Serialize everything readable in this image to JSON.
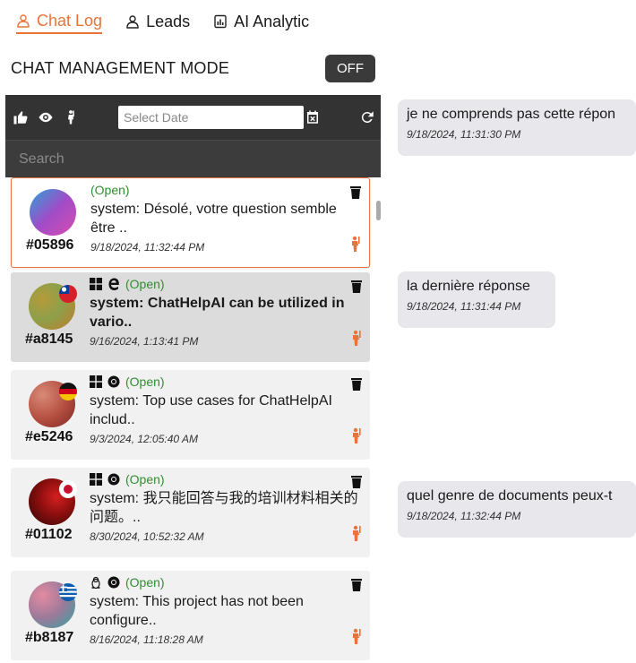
{
  "tabs": [
    {
      "label": "Chat Log",
      "icon": "user-icon",
      "active": true
    },
    {
      "label": "Leads",
      "icon": "person-icon",
      "active": false
    },
    {
      "label": "AI Analytic",
      "icon": "analytics-icon",
      "active": false
    }
  ],
  "mode": {
    "title": "CHAT MANAGEMENT MODE",
    "toggle_label": "OFF"
  },
  "toolbar": {
    "date_placeholder": "Select Date",
    "search_placeholder": "Search"
  },
  "chats": [
    {
      "id": "#05896",
      "status": "(Open)",
      "message": "system: Désolé, votre question semble être ..",
      "time": "9/18/2024, 11:32:44 PM",
      "bold": false,
      "os": "",
      "browser": "",
      "flag": ""
    },
    {
      "id": "#a8145",
      "status": "(Open)",
      "message": "system: ChatHelpAI can be utilized in vario..",
      "time": "9/16/2024, 1:13:41 PM",
      "bold": true,
      "os": "windows-icon",
      "browser": "edge-icon",
      "flag": "taiwan-flag-icon"
    },
    {
      "id": "#e5246",
      "status": "(Open)",
      "message": "system: Top use cases for ChatHelpAI includ..",
      "time": "9/3/2024, 12:05:40 AM",
      "bold": false,
      "os": "windows-icon",
      "browser": "chrome-icon",
      "flag": "germany-flag-icon"
    },
    {
      "id": "#01102",
      "status": "(Open)",
      "message": "system: 我只能回答与我的培训材料相关的问题。..",
      "time": "8/30/2024, 10:52:32 AM",
      "bold": false,
      "os": "windows-icon",
      "browser": "chrome-icon",
      "flag": "japan-flag-icon"
    },
    {
      "id": "#b8187",
      "status": "(Open)",
      "message": "system: This project has not been configure..",
      "time": "8/16/2024, 11:18:28 AM",
      "bold": false,
      "os": "linux-icon",
      "browser": "chrome-icon",
      "flag": "greece-flag-icon"
    }
  ],
  "conversation": [
    {
      "text": "je ne comprends pas cette répon",
      "time": "9/18/2024, 11:31:30 PM"
    },
    {
      "text": "la dernière réponse",
      "time": "9/18/2024, 11:31:44 PM"
    },
    {
      "text": "quel genre de documents peux-t",
      "time": "9/18/2024, 11:32:44 PM"
    }
  ],
  "colors": {
    "accent": "#e8743b",
    "open_status": "#2f8f2f",
    "toolbar_bg": "#333333",
    "selected_card": "#dcdcdc",
    "bubble_bg": "#e8e8ec"
  }
}
